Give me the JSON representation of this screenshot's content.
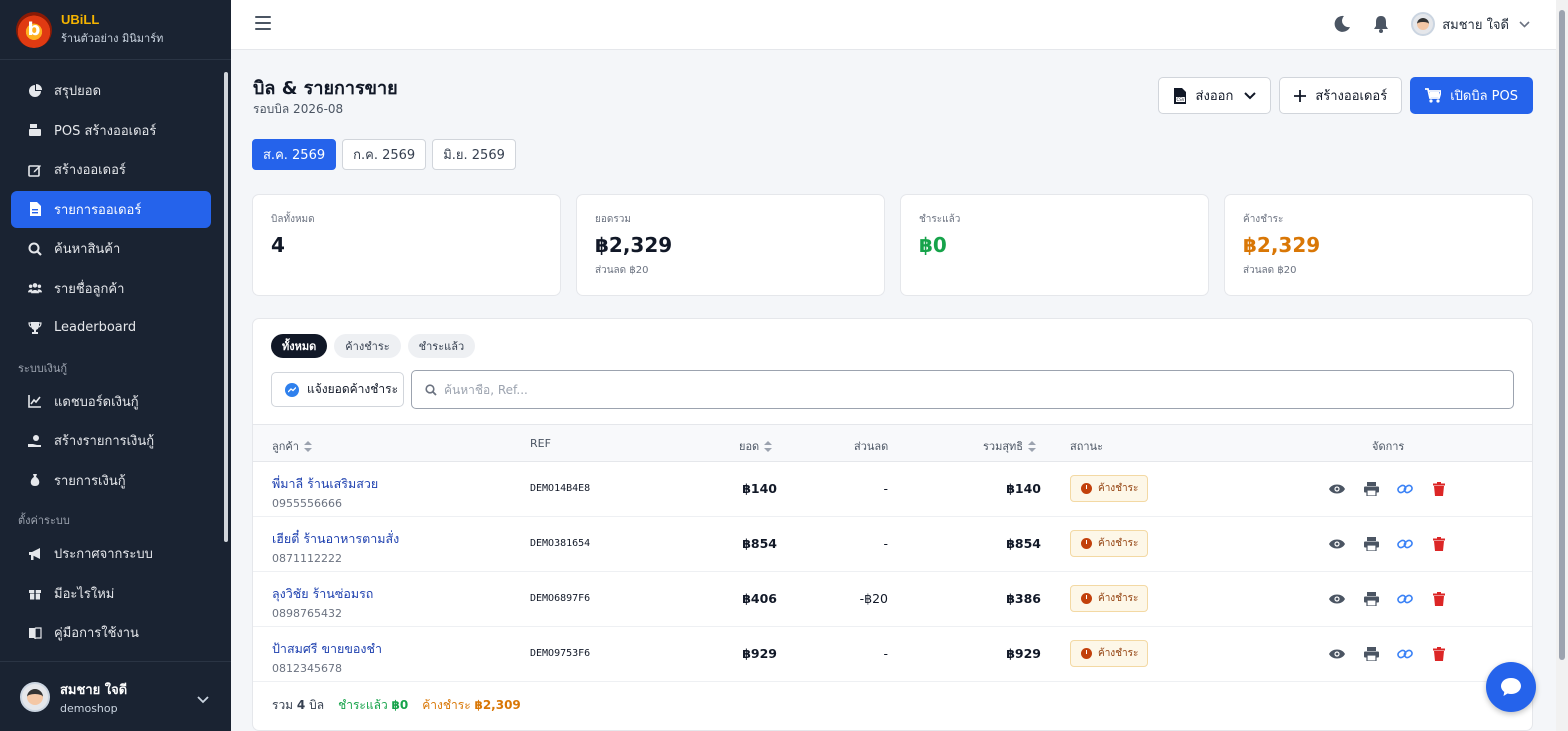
{
  "brand": {
    "name": "UBiLL",
    "shop": "ร้านตัวอย่าง มินิมาร์ท"
  },
  "sidebar": {
    "items": [
      {
        "label": "สรุปยอด",
        "icon": "pie-chart-icon"
      },
      {
        "label": "POS สร้างออเดอร์",
        "icon": "cash-register-icon"
      },
      {
        "label": "สร้างออเดอร์",
        "icon": "edit-icon"
      },
      {
        "label": "รายการออเดอร์",
        "icon": "file-icon",
        "active": true
      },
      {
        "label": "ค้นหาสินค้า",
        "icon": "search-icon"
      },
      {
        "label": "รายชื่อลูกค้า",
        "icon": "users-icon"
      },
      {
        "label": "Leaderboard",
        "icon": "trophy-icon"
      }
    ],
    "section_loan": "ระบบเงินกู้",
    "loan_items": [
      {
        "label": "แดชบอร์ดเงินกู้",
        "icon": "chart-line-icon"
      },
      {
        "label": "สร้างรายการเงินกู้",
        "icon": "hand-coin-icon"
      },
      {
        "label": "รายการเงินกู้",
        "icon": "money-bag-icon"
      }
    ],
    "section_settings": "ตั้งค่าระบบ",
    "settings_items": [
      {
        "label": "ประกาศจากระบบ",
        "icon": "megaphone-icon"
      },
      {
        "label": "มีอะไรใหม่",
        "icon": "gift-icon"
      },
      {
        "label": "คู่มือการใช้งาน",
        "icon": "book-icon"
      }
    ],
    "user": {
      "name": "สมชาย ใจดี",
      "username": "demoshop"
    }
  },
  "topbar": {
    "user_name": "สมชาย ใจดี"
  },
  "page": {
    "title": "บิล & รายการขาย",
    "subtitle": "รอบบิล 2026-08"
  },
  "actions": {
    "export": "ส่งออก",
    "create_order": "สร้างออเดอร์",
    "open_pos": "เปิดบิล POS"
  },
  "periods": [
    {
      "label": "ส.ค. 2569",
      "active": true
    },
    {
      "label": "ก.ค. 2569",
      "active": false
    },
    {
      "label": "มิ.ย. 2569",
      "active": false
    }
  ],
  "stats": [
    {
      "label": "บิลทั้งหมด",
      "value": "4",
      "note": "",
      "color": "#111827"
    },
    {
      "label": "ยอดรวม",
      "value": "฿2,329",
      "note": "ส่วนลด ฿20",
      "color": "#111827"
    },
    {
      "label": "ชำระแล้ว",
      "value": "฿0",
      "note": "",
      "color": "#16a34a"
    },
    {
      "label": "ค้างชำระ",
      "value": "฿2,329",
      "note": "ส่วนลด ฿20",
      "color": "#d97706"
    }
  ],
  "filters": {
    "all": "ทั้งหมด",
    "unpaid": "ค้างชำระ",
    "paid": "ชำระแล้ว"
  },
  "notify_button": "แจ้งยอดค้างชำระ",
  "search": {
    "placeholder": "ค้นหาชื่อ, Ref..."
  },
  "table": {
    "headers": {
      "customer": "ลูกค้า",
      "ref": "REF",
      "amount": "ยอด",
      "discount": "ส่วนลด",
      "net": "รวมสุทธิ",
      "status": "สถานะ",
      "actions": "จัดการ"
    },
    "rows": [
      {
        "name": "พี่มาลี ร้านเสริมสวย",
        "phone": "0955556666",
        "ref": "DEMO14B4E8",
        "amount": "฿140",
        "discount": "-",
        "net": "฿140",
        "status": "ค้างชำระ"
      },
      {
        "name": "เฮียตี๋ ร้านอาหารตามสั่ง",
        "phone": "0871112222",
        "ref": "DEMO381654",
        "amount": "฿854",
        "discount": "-",
        "net": "฿854",
        "status": "ค้างชำระ"
      },
      {
        "name": "ลุงวิชัย ร้านซ่อมรถ",
        "phone": "0898765432",
        "ref": "DEMO6897F6",
        "amount": "฿406",
        "discount": "-฿20",
        "net": "฿386",
        "status": "ค้างชำระ"
      },
      {
        "name": "ป้าสมศรี ขายของชำ",
        "phone": "0812345678",
        "ref": "DEMO9753F6",
        "amount": "฿929",
        "discount": "-",
        "net": "฿929",
        "status": "ค้างชำระ"
      }
    ]
  },
  "footer": {
    "total_prefix": "รวม",
    "total_count": "4",
    "total_suffix": "บิล",
    "paid_label": "ชำระแล้ว",
    "paid_value": "฿0",
    "unpaid_label": "ค้างชำระ",
    "unpaid_value": "฿2,309"
  }
}
